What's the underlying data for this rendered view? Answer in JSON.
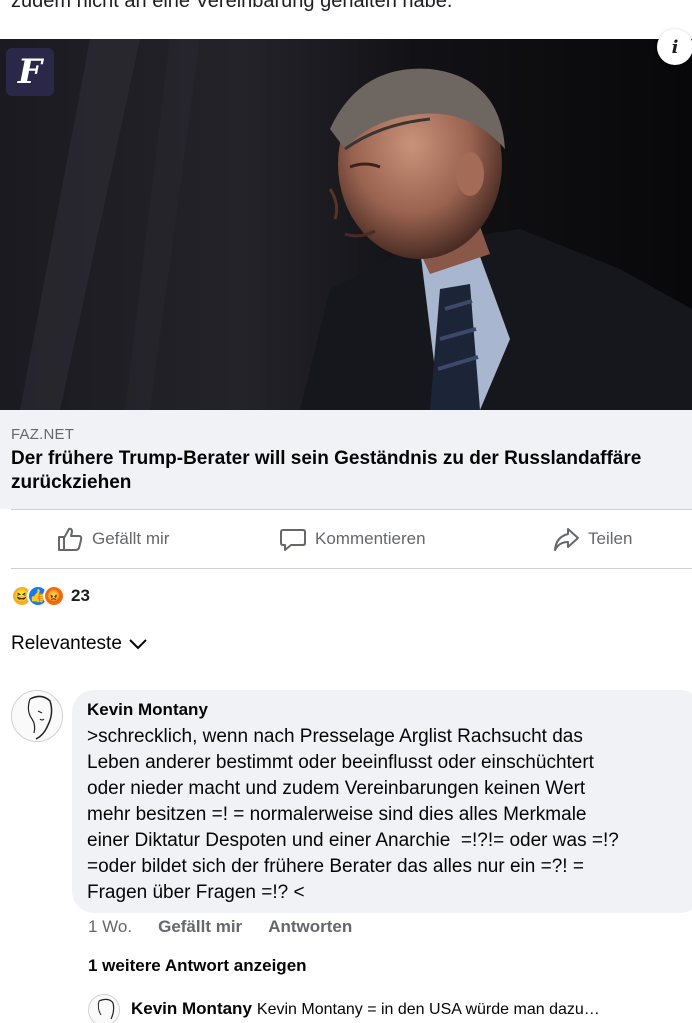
{
  "post": {
    "caption_cut": "zudem nicht an eine Vereinbarung gehalten habe."
  },
  "link": {
    "source": "FAZ.NET",
    "title": "Der frühere Trump-Berater will sein Geständnis zu der Russlandaffäre zurückziehen",
    "logo_icon": "faz-logo",
    "info_icon": "info-icon"
  },
  "actions": {
    "like_label": "Gefällt mir",
    "comment_label": "Kommentieren",
    "share_label": "Teilen"
  },
  "reactions": {
    "types": [
      "haha",
      "like",
      "angry"
    ],
    "count": "23"
  },
  "sort": {
    "label": "Relevanteste"
  },
  "comment": {
    "author": "Kevin Montany",
    "text": ">schrecklich, wenn nach Presselage Arglist Rachsucht das\nLeben anderer bestimmt oder beeinflusst oder einschüchtert\noder nieder macht und zudem Vereinbarungen keinen Wert\nmehr besitzen =! = normalerweise sind dies alles Merkmale\neiner Diktatur Despoten und einer Anarchie  =!?!= oder was =!?\n=oder bildet sich der frühere Berater das alles nur ein =?! =\nFragen über Fragen =!? <",
    "time": "1 Wo.",
    "like_label": "Gefällt mir",
    "reply_label": "Antworten",
    "more_replies": "1 weitere Antwort anzeigen"
  },
  "reply": {
    "author": "Kevin Montany",
    "snippet": "Kevin Montany = in den USA würde man dazu…"
  },
  "colors": {
    "text": "#050505",
    "muted": "#65676b",
    "bubble": "#f0f2f5",
    "faz_logo_bg": "#2b2748"
  }
}
